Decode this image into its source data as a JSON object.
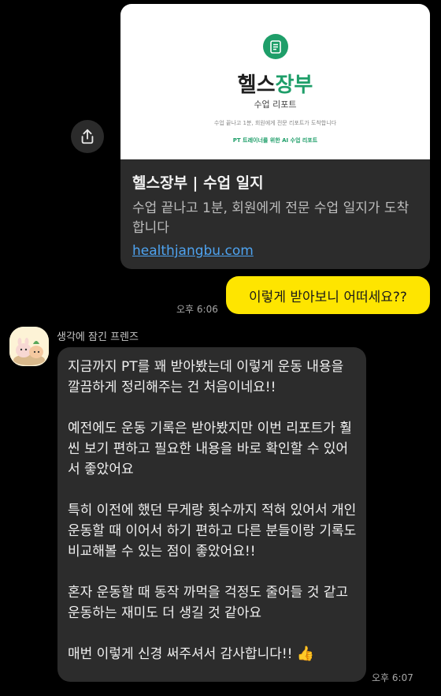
{
  "link_preview": {
    "image": {
      "brand_part1": "헬스",
      "brand_part2": "장부",
      "subtitle": "수업 리포트",
      "tiny_text": "수업 끝나고 1분, 회원에게 전문 리포트가 도착합니다",
      "tagline": "PT 트레이너를 위한 AI 수업 리포트",
      "logo_color": "#1e9e69"
    },
    "title": "헬스장부 | 수업 일지",
    "description": "수업 끝나고 1분, 회원에게 전문 수업 일지가 도착합니다",
    "url": "healthjangbu.com"
  },
  "share_icon": "share-icon",
  "sent_message": {
    "text": "이렇게 받아보니 어떠세요??",
    "time": "오후 6:06",
    "bubble_color": "#fee500"
  },
  "received_message": {
    "sender": "생각에 잠긴 프렌즈",
    "paragraphs": [
      "지금까지 PT를 꽤 받아봤는데 이렇게 운동 내용을 깔끔하게 정리해주는 건 처음이네요!!",
      "예전에도 운동 기록은 받아봤지만 이번 리포트가 훨씬 보기 편하고 필요한 내용을 바로 확인할 수 있어서 좋았어요",
      "특히 이전에 했던 무게랑 횟수까지 적혀 있어서 개인 운동할 때 이어서 하기 편하고 다른 분들이랑 기록도 비교해볼 수 있는 점이 좋았어요!!",
      "혼자 운동할 때 동작 까먹을 걱정도 줄어들 것 같고 운동하는 재미도 더 생길 것 같아요",
      "매번 이렇게 신경 써주셔서 감사합니다!!"
    ],
    "emoji": "👍",
    "time": "오후 6:07"
  }
}
